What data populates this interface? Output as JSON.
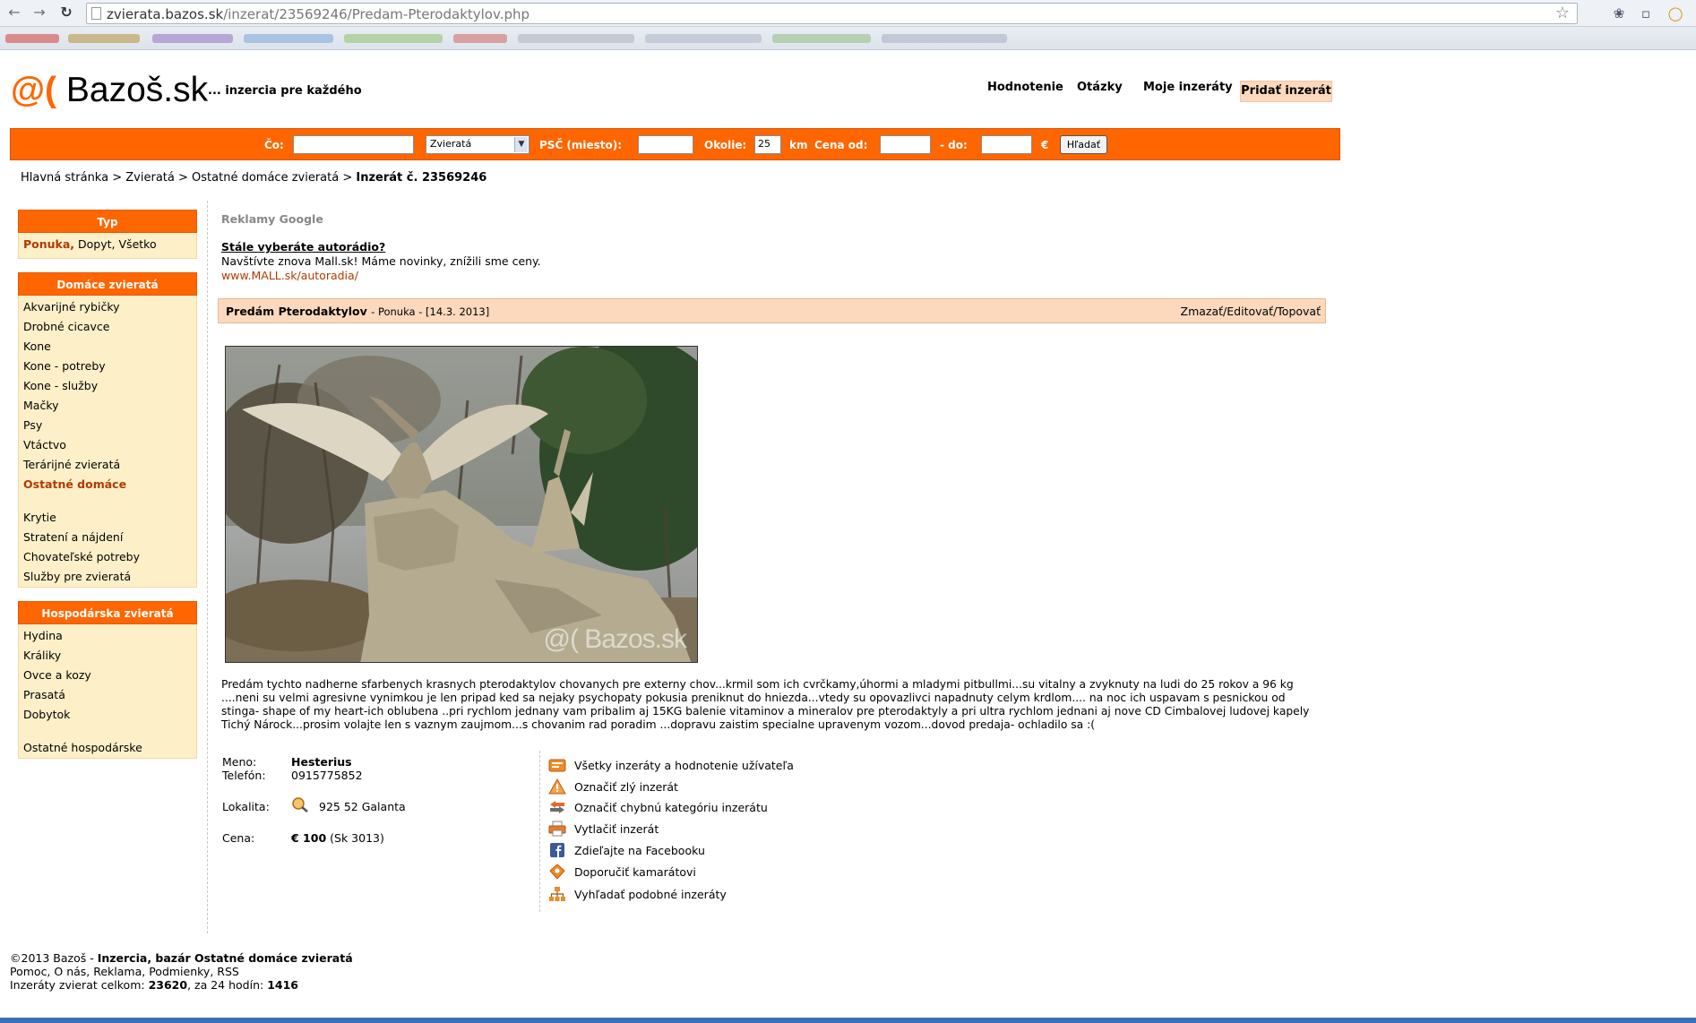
{
  "browser": {
    "url_host": "zvierata.bazos.sk",
    "url_path": "/inzerat/23569246/Predam-Pterodaktylov.php",
    "back_icon": "back-arrow-icon",
    "forward_icon": "forward-arrow-icon",
    "reload_icon": "reload-icon"
  },
  "header": {
    "logo_symbol": "@(",
    "logo_name": "Bazoš.sk",
    "tagline": "... inzercia pre každého",
    "nav": [
      "Hodnotenie",
      "Otázky",
      "Moje inzeráty",
      "Pridať inzerát"
    ]
  },
  "search": {
    "co_label": "Čo:",
    "category_value": "Zvieratá",
    "psc_label": "PSČ (miesto):",
    "okolie_label": "Okolie:",
    "okolie_value": "25",
    "km_label": "km",
    "cena_od_label": "Cena od:",
    "do_label": "- do:",
    "currency": "€",
    "button_label": "Hľadať"
  },
  "breadcrumb": {
    "items": [
      "Hlavná stránka",
      "Zvieratá",
      "Ostatné domáce zvieratá"
    ],
    "separator": ">",
    "current": "Inzerát č. 23569246"
  },
  "sidebar": {
    "typ": {
      "title": "Typ",
      "items": [
        "Ponuka,",
        "Dopyt,",
        "Všetko"
      ]
    },
    "domace": {
      "title": "Domáce zvieratá",
      "items": [
        "Akvarijné rybičky",
        "Drobné cicavce",
        "Kone",
        "Kone - potreby",
        "Kone - služby",
        "Mačky",
        "Psy",
        "Vtáctvo",
        "Terárijné zvieratá",
        "Ostatné domáce"
      ],
      "items2": [
        "Krytie",
        "Stratení a nájdení",
        "Chovateľské potreby",
        "Služby pre zvieratá"
      ]
    },
    "hospodarske": {
      "title": "Hospodárska zvieratá",
      "items": [
        "Hydina",
        "Králiky",
        "Ovce a kozy",
        "Prasatá",
        "Dobytok"
      ],
      "items2": [
        "Ostatné hospodárske"
      ]
    }
  },
  "ads": {
    "title": "Reklamy Google",
    "link": "Stále vyberáte autorádio?",
    "text": "Navštívte znova Mall.sk! Máme novinky, znížili sme ceny.",
    "url": "www.MALL.sk/autoradia/"
  },
  "listing": {
    "title": "Predám Pterodaktylov",
    "meta": "- Ponuka - [14.3. 2013]",
    "actions": "Zmazať/Editovať/Topovať",
    "watermark": "@( Bazos.sk",
    "description": [
      "Predám tychto nadherne sfarbenych krasnych pterodaktylov chovanych pre externy chov...krmil som ich cvrčkamy,úhormi a mladymi pitbullmi...su vitalny a zvyknuty na ludi do 25 rokov a 96 kg",
      "....neni su velmi agresivne vynimkou je len pripad ked sa nejaky psychopaty pokusia preniknut do hniezda...vtedy su opovazlivci napadnuty celym krdlom.... na noc ich uspavam s pesnickou od",
      "stinga- shape of my heart-ich oblubena ..pri rychlom jednany vam pribalim aj 15KG balenie vitaminov a mineralov pre pterodaktyly a pri ultra rychlom jednani aj nove CD Cimbalovej ludovej kapely",
      "Tichý Nárock...prosim volajte len s vaznym zaujmom...s chovanim rad poradim ...dopravu zaistim specialne upravenym vozom...dovod predaja- ochladilo sa :("
    ],
    "meno_label": "Meno:",
    "meno_value": "Hesterius",
    "telefon_label": "Telefón:",
    "telefon_value": "0915775852",
    "lokalita_label": "Lokalita:",
    "lokalita_value": "925 52 Galanta",
    "cena_label": "Cena:",
    "cena_value": "€ 100",
    "cena_sk": "(Sk 3013)"
  },
  "actions": [
    {
      "icon": "user-listings-icon",
      "label": "Všetky inzeráty a hodnotenie užívateľa"
    },
    {
      "icon": "warning-icon",
      "label": "Označiť zlý inzerát"
    },
    {
      "icon": "swap-arrows-icon",
      "label": "Označiť chybnú kategóriu inzerátu"
    },
    {
      "icon": "printer-icon",
      "label": "Vytlačiť inzerát"
    },
    {
      "icon": "facebook-icon",
      "label": "Zdieľajte na Facebooku"
    },
    {
      "icon": "recommend-icon",
      "label": "Doporučiť kamarátovi"
    },
    {
      "icon": "sitemap-icon",
      "label": "Vyhľadať podobné inzeráty"
    }
  ],
  "footer": {
    "copyright": "©2013 Bazoš -",
    "copyright_bold": "Inzercia, bazár Ostatné domáce zvieratá",
    "links": "Pomoc, O nás, Reklama, Podmienky, RSS",
    "stats_prefix": "Inzeráty zvierat celkom:",
    "stats_total": "23620",
    "stats_mid": ", za 24 hodín:",
    "stats_24h": "1416"
  },
  "colors": {
    "brand_orange": "#ff6600",
    "sidebar_bg": "#fdf0c8",
    "listing_bar_bg": "#fcd9bd",
    "active_link": "#b03a00"
  }
}
